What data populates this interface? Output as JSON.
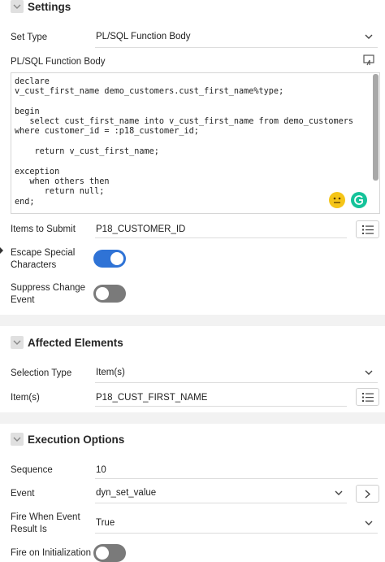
{
  "settings": {
    "title": "Settings",
    "set_type": {
      "label": "Set Type",
      "value": "PL/SQL Function Body"
    },
    "function_body": {
      "label": "PL/SQL Function Body",
      "code": "declare\nv_cust_first_name demo_customers.cust_first_name%type;\n\nbegin\n   select cust_first_name into v_cust_first_name from demo_customers\nwhere customer_id = :p18_customer_id;\n\n    return v_cust_first_name;\n\nexception\n   when others then\n      return null;\nend;"
    },
    "items_to_submit": {
      "label": "Items to Submit",
      "value": "P18_CUSTOMER_ID"
    },
    "escape_special": {
      "label_line1": "Escape Special",
      "label_line2": "Characters",
      "state": "on"
    },
    "suppress_change": {
      "label_line1": "Suppress Change",
      "label_line2": "Event",
      "state": "off"
    }
  },
  "affected": {
    "title": "Affected Elements",
    "selection_type": {
      "label": "Selection Type",
      "value": "Item(s)"
    },
    "items": {
      "label": "Item(s)",
      "value": "P18_CUST_FIRST_NAME"
    }
  },
  "execution": {
    "title": "Execution Options",
    "sequence": {
      "label": "Sequence",
      "value": "10"
    },
    "event": {
      "label": "Event",
      "value": "dyn_set_value"
    },
    "fire_when": {
      "label_line1": "Fire When Event",
      "label_line2": "Result Is",
      "value": "True"
    },
    "fire_on_init": {
      "label": "Fire on Initialization",
      "state": "off"
    }
  },
  "colors": {
    "toggle_on": "#2f73d6",
    "toggle_off": "#7a7a7a",
    "band": "#f2f2f2",
    "grammarly": "#15c39a",
    "emoji": "#f5c518"
  }
}
